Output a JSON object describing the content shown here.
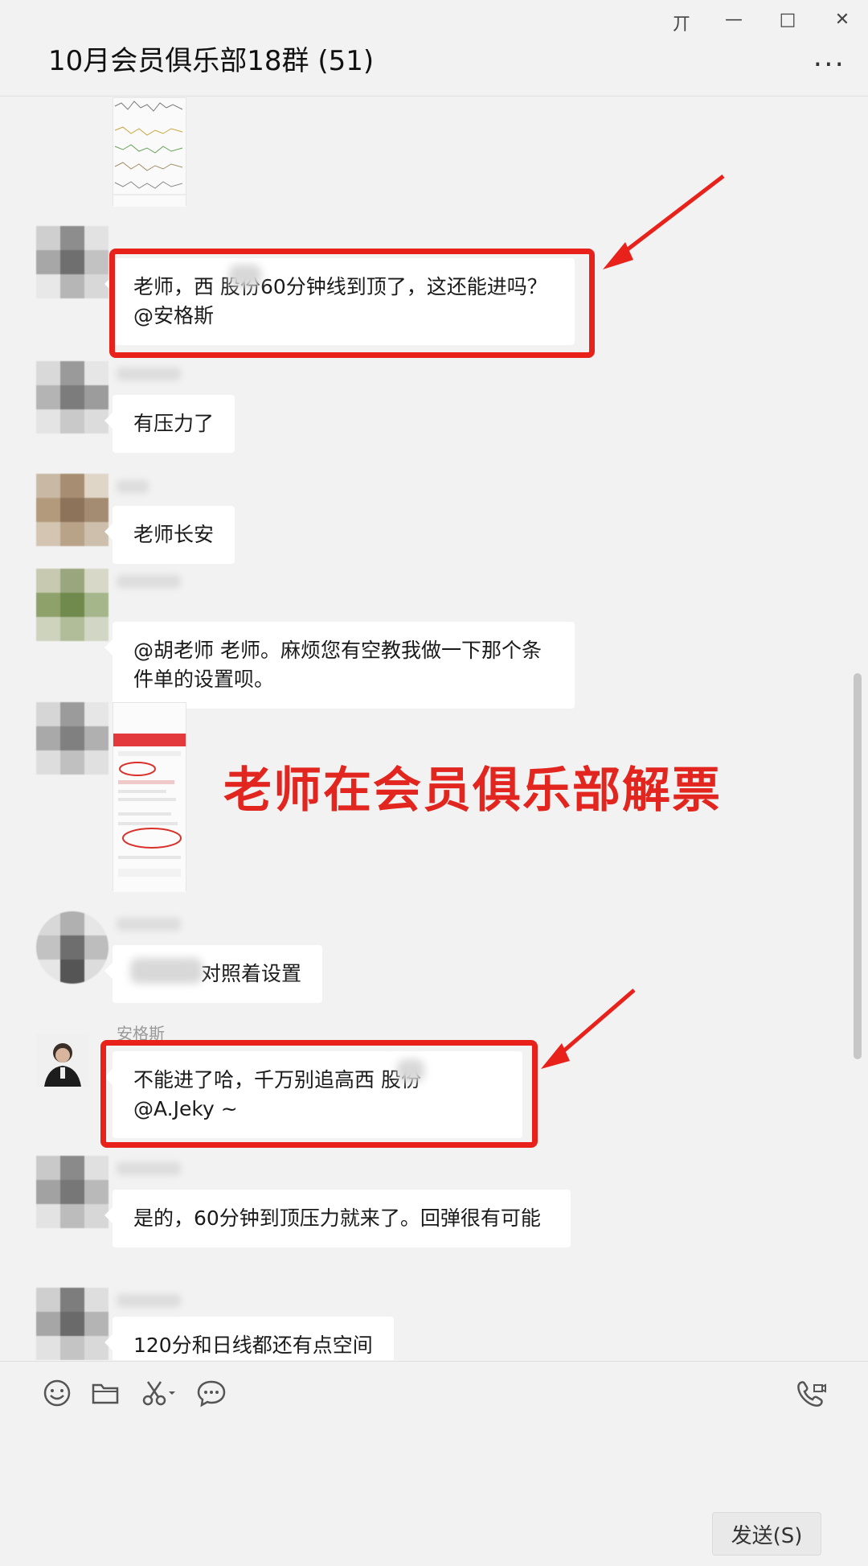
{
  "window": {
    "title": "10月会员俱乐部18群 (51)",
    "controls": {
      "pin": "丌",
      "minimize": "—",
      "maximize": "□",
      "close": "✕"
    },
    "more": "···"
  },
  "messages": [
    {
      "nick": "",
      "text": "老师，西    股份60分钟线到顶了，这还能进吗？@安格斯",
      "highlighted": true
    },
    {
      "nick": "",
      "text": "有压力了",
      "highlighted": false
    },
    {
      "nick": "",
      "text": "老师长安",
      "highlighted": false
    },
    {
      "nick": "",
      "text": "@胡老师 老师。麻烦您有空教我做一下那个条件单的设置呗。",
      "highlighted": false
    },
    {
      "nick": "",
      "text": "",
      "type": "image",
      "highlighted": false
    },
    {
      "nick": "",
      "text": "对照着设置",
      "highlighted": false
    },
    {
      "nick": "安格斯",
      "text": "不能进了哈，千万别追高西    股份@A.Jeky ~",
      "highlighted": true
    },
    {
      "nick": "",
      "text": "是的，60分钟到顶压力就来了。回弹很有可能",
      "highlighted": false
    },
    {
      "nick": "",
      "text": "120分和日线都还有点空间",
      "highlighted": false
    }
  ],
  "overlay_caption": "老师在会员俱乐部解票",
  "toolbar": {
    "icons": [
      "emoji-icon",
      "folder-icon",
      "scissors-icon",
      "chat-bubble-icon",
      "phone-video-icon"
    ]
  },
  "send_label": "发送(S)",
  "colors": {
    "accent_red": "#e8221b",
    "bg": "#f2f2f2",
    "bubble": "#ffffff"
  }
}
